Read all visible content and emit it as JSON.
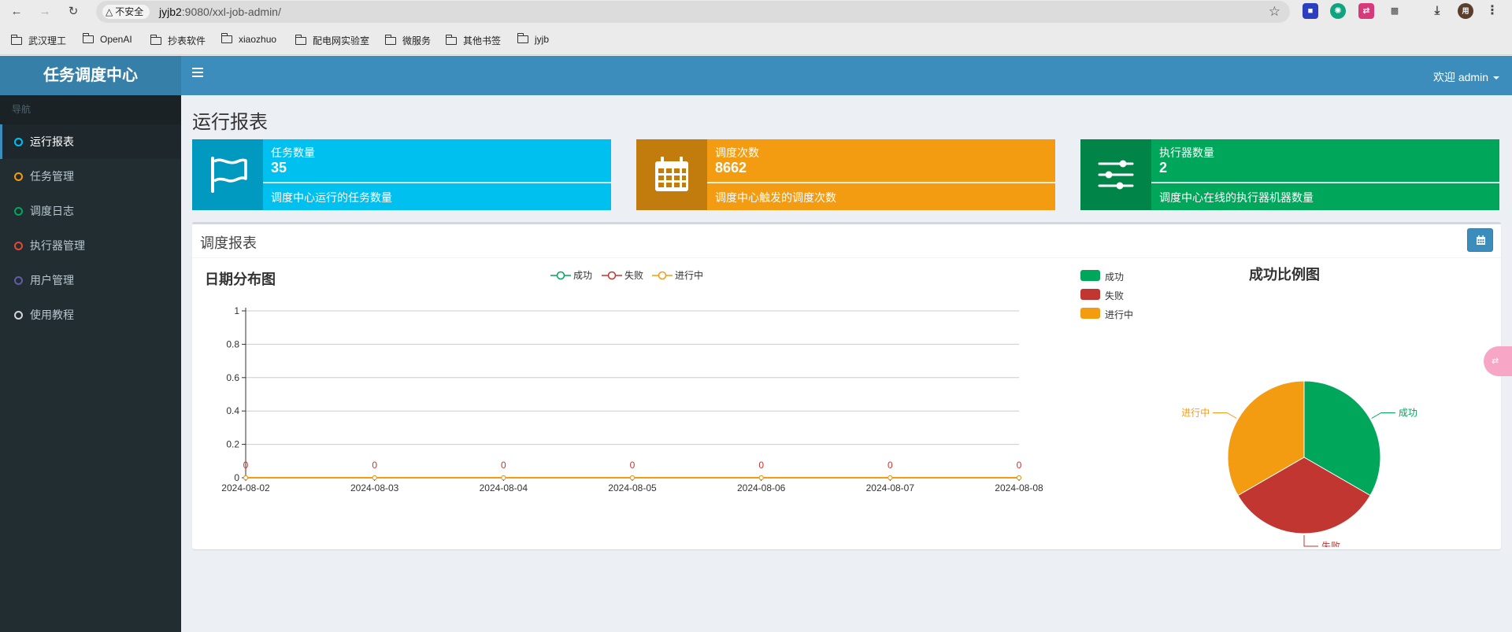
{
  "browser": {
    "insecure_label": "不安全",
    "url_host": "jyjb2",
    "url_rest": ":9080/xxl-job-admin/",
    "bookmarks": [
      "武汉理工",
      "OpenAI",
      "抄表软件",
      "xiaozhuo",
      "配电网实验室",
      "微服务",
      "其他书签",
      "jyjb"
    ]
  },
  "app": {
    "logo": "任务调度中心",
    "welcome": "欢迎 admin"
  },
  "sidebar": {
    "header": "导航",
    "items": [
      {
        "label": "运行报表",
        "ring": "#00c0ef"
      },
      {
        "label": "任务管理",
        "ring": "#f39c12"
      },
      {
        "label": "调度日志",
        "ring": "#00a65a"
      },
      {
        "label": "执行器管理",
        "ring": "#dd4b39"
      },
      {
        "label": "用户管理",
        "ring": "#605ca8"
      },
      {
        "label": "使用教程",
        "ring": "#d2d6de"
      }
    ]
  },
  "page": {
    "title": "运行报表"
  },
  "info_boxes": [
    {
      "label": "任务数量",
      "value": "35",
      "desc": "调度中心运行的任务数量",
      "color": "#00c0ef",
      "icon": "flag-icon"
    },
    {
      "label": "调度次数",
      "value": "8662",
      "desc": "调度中心触发的调度次数",
      "color": "#f39c12",
      "icon": "calendar-icon"
    },
    {
      "label": "执行器数量",
      "value": "2",
      "desc": "调度中心在线的执行器机器数量",
      "color": "#00a65a",
      "icon": "sliders-icon"
    }
  ],
  "report": {
    "title": "调度报表"
  },
  "chart_data": [
    {
      "type": "line",
      "title": "日期分布图",
      "x": [
        "2024-08-02",
        "2024-08-03",
        "2024-08-04",
        "2024-08-05",
        "2024-08-06",
        "2024-08-07",
        "2024-08-08"
      ],
      "series": [
        {
          "name": "成功",
          "values": [
            0,
            0,
            0,
            0,
            0,
            0,
            0
          ],
          "color": "#00a65a"
        },
        {
          "name": "失败",
          "values": [
            0,
            0,
            0,
            0,
            0,
            0,
            0
          ],
          "color": "#c23632"
        },
        {
          "name": "进行中",
          "values": [
            0,
            0,
            0,
            0,
            0,
            0,
            0
          ],
          "color": "#f39c12"
        }
      ],
      "ylim": [
        0,
        1
      ],
      "yticks": [
        "0",
        "0.2",
        "0.4",
        "0.6",
        "0.8",
        "1"
      ],
      "data_labels": [
        "0",
        "0",
        "0",
        "0",
        "0",
        "0",
        "0"
      ],
      "grid": true,
      "legend": "top-center"
    },
    {
      "type": "pie",
      "title": "成功比例图",
      "slices": [
        {
          "name": "成功",
          "value": 1,
          "color": "#00a65a"
        },
        {
          "name": "失败",
          "value": 1,
          "color": "#c23632"
        },
        {
          "name": "进行中",
          "value": 1,
          "color": "#f39c12"
        }
      ],
      "legend": "top-left"
    }
  ]
}
